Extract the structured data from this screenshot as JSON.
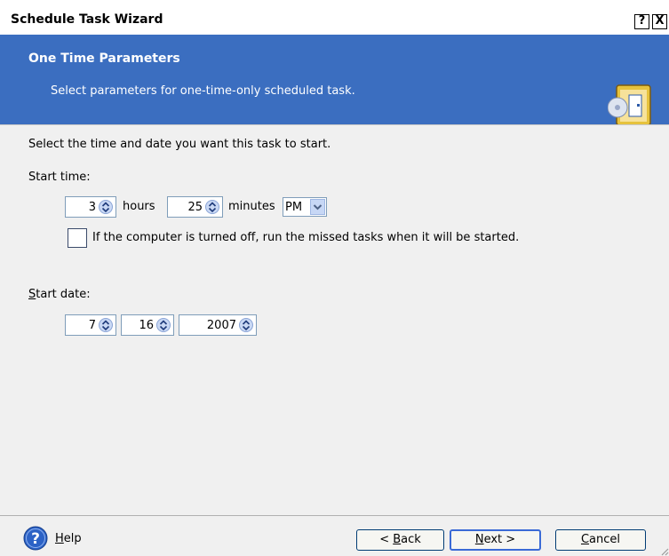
{
  "window": {
    "title": "Schedule Task Wizard",
    "help_btn": "?",
    "close_btn": "X"
  },
  "header": {
    "title": "One Time Parameters",
    "subtitle": "Select parameters for one-time-only scheduled task.",
    "icon": "schedule-wizard-icon"
  },
  "content": {
    "intro": "Select the time and date you want this task to start.",
    "start_time_label": "Start time:",
    "hours_value": "3",
    "hours_label": "hours",
    "minutes_value": "25",
    "minutes_label": "minutes",
    "ampm_value": "PM",
    "missed_tasks_label": "If the computer is turned off, run the missed tasks when it will be started.",
    "missed_tasks_checked": false,
    "start_date_label_s": "S",
    "start_date_label_rest": "tart date:",
    "month_value": "7",
    "day_value": "16",
    "year_value": "2007"
  },
  "footer": {
    "help_u": "H",
    "help_rest": "elp",
    "back_pre": "< ",
    "back_u": "B",
    "back_rest": "ack",
    "next_u": "N",
    "next_rest": "ext >",
    "cancel_u": "C",
    "cancel_rest": "ancel"
  },
  "colors": {
    "header_bg": "#3b6ec0",
    "content_bg": "#f0f0f0",
    "input_border": "#7f9db9"
  }
}
